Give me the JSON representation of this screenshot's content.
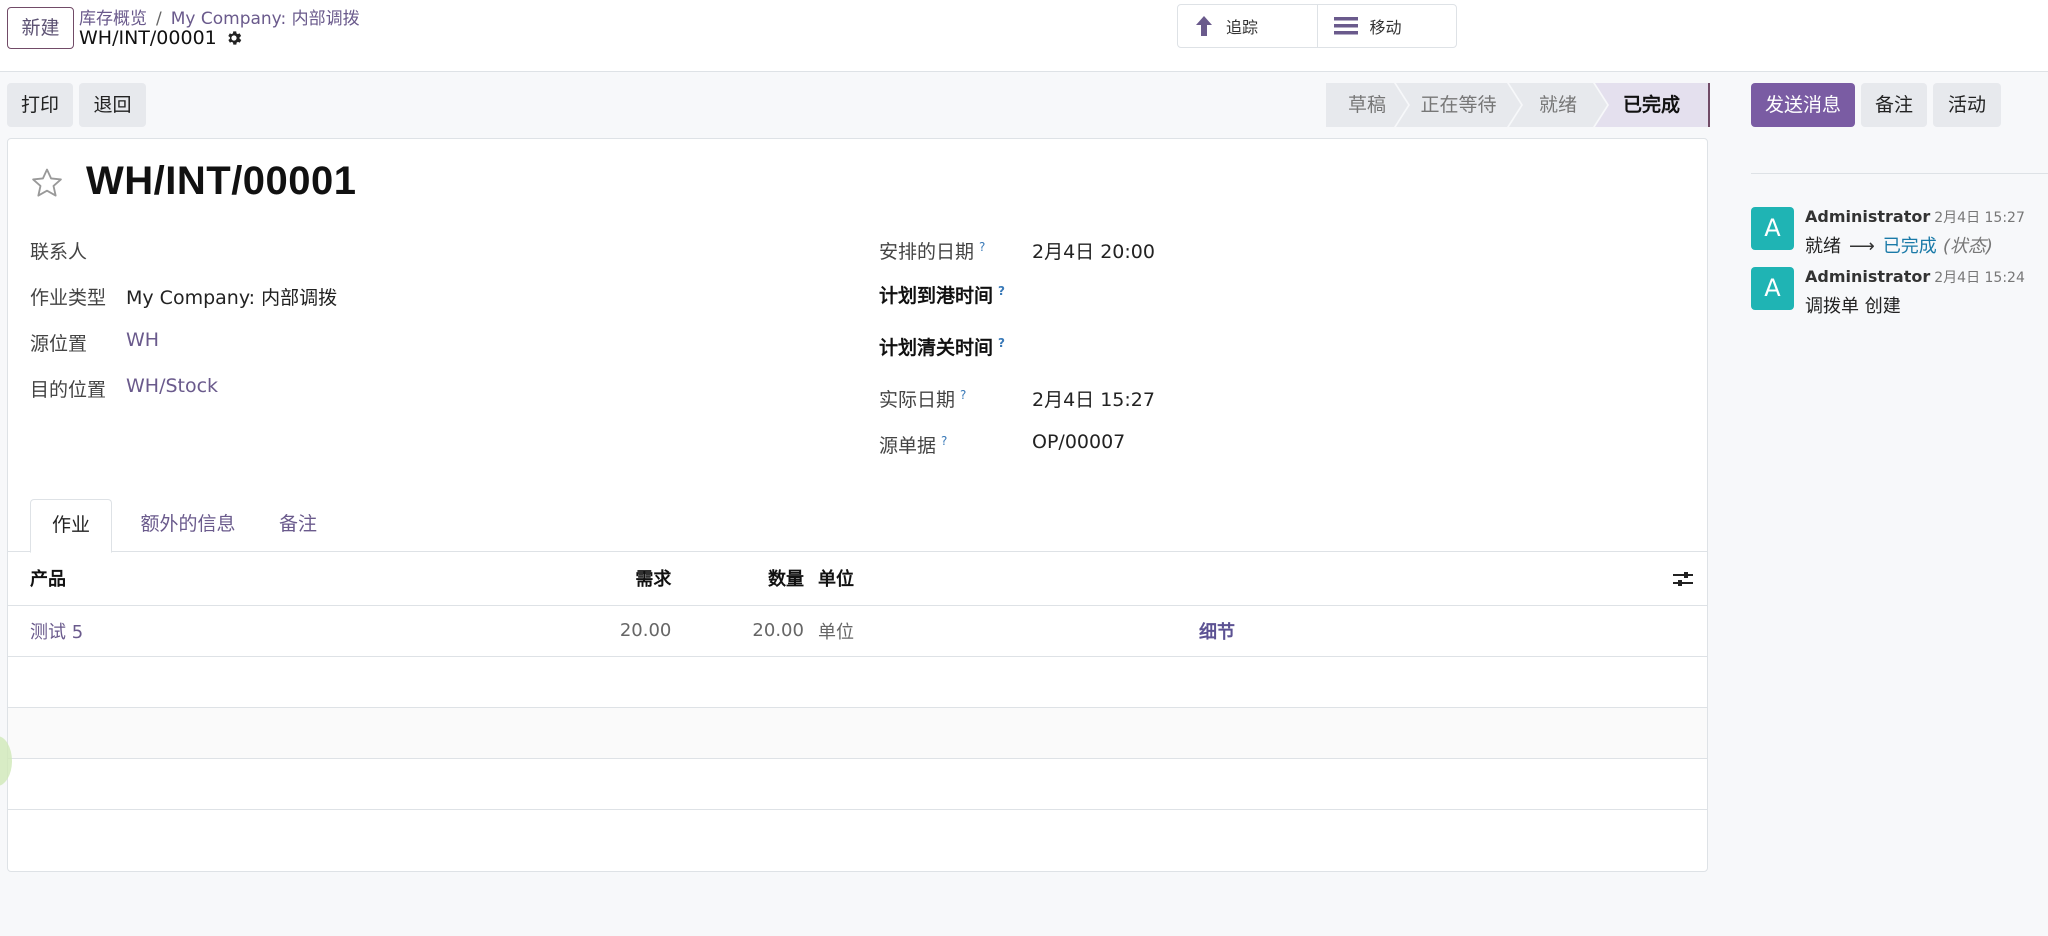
{
  "control_panel": {
    "new_button": "新建",
    "breadcrumb": [
      "库存概览",
      "My Company: 内部调拨"
    ],
    "record_name": "WH/INT/00001",
    "smart_buttons": [
      {
        "label": "追踪",
        "icon": "arrow-up-icon"
      },
      {
        "label": "移动",
        "icon": "list-icon"
      }
    ]
  },
  "action_buttons": {
    "print": "打印",
    "return": "退回"
  },
  "statusbar": {
    "stages": [
      "草稿",
      "正在等待",
      "就绪",
      "已完成"
    ],
    "active": "已完成"
  },
  "chatter_buttons": {
    "send_message": "发送消息",
    "log_note": "备注",
    "activities": "活动"
  },
  "form": {
    "title": "WH/INT/00001",
    "left_fields": [
      {
        "label": "联系人",
        "value": ""
      },
      {
        "label": "作业类型",
        "value": "My Company: 内部调拨"
      },
      {
        "label": "源位置",
        "value": "WH"
      },
      {
        "label": "目的位置",
        "value": "WH/Stock"
      }
    ],
    "right_fields": [
      {
        "label": "安排的日期",
        "help": "?",
        "value": "2月4日 20:00"
      },
      {
        "label": "计划到港时间",
        "help": "?",
        "value": ""
      },
      {
        "label": "计划清关时间",
        "help": "?",
        "value": ""
      },
      {
        "label": "实际日期",
        "help": "?",
        "value": "2月4日 15:27"
      },
      {
        "label": "源单据",
        "help": "?",
        "value": "OP/00007"
      }
    ]
  },
  "tabs": [
    "作业",
    "额外的信息",
    "备注"
  ],
  "operations": {
    "columns": [
      "产品",
      "需求",
      "数量",
      "单位"
    ],
    "rows": [
      {
        "product": "测试 5",
        "demand": "20.00",
        "quantity": "20.00",
        "uom": "单位",
        "detail": "细节"
      }
    ]
  },
  "chatter": {
    "messages": [
      {
        "avatar": "A",
        "author": "Administrator",
        "date": "2月4日 15:27",
        "old_value": "就绪",
        "arrow": "⟶",
        "new_value": "已完成",
        "field": "(状态)"
      },
      {
        "avatar": "A",
        "author": "Administrator",
        "date": "2月4日 15:24",
        "body": "调拨单 创建"
      }
    ]
  },
  "colors": {
    "brand": "#714b67",
    "primary_button": "#7a5ca3",
    "link": "#6a5a8c",
    "avatar": "#1fb4b4"
  }
}
